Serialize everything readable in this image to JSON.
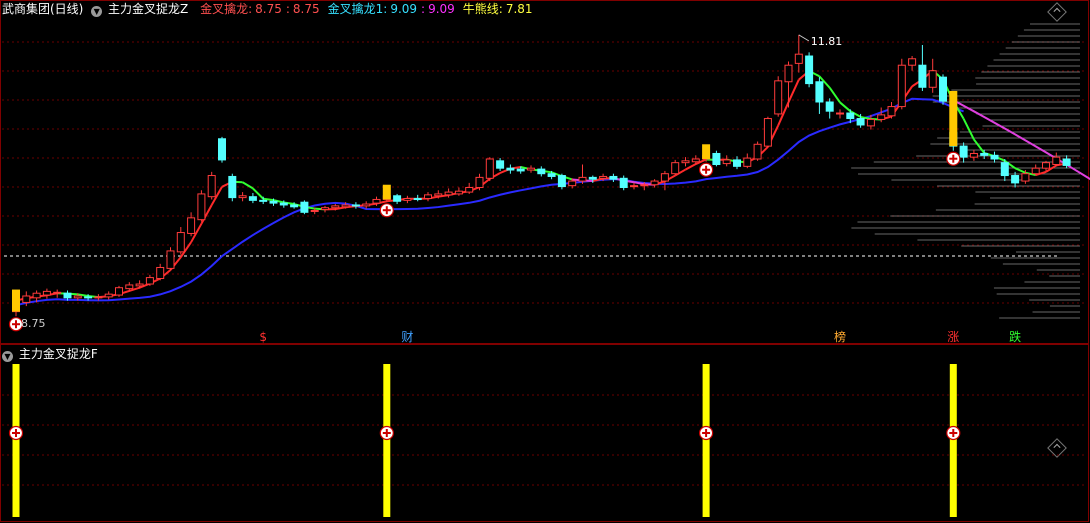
{
  "main_panel": {
    "stock_name": "武商集团(日线)",
    "indicator_name": "主力金叉捉龙Z",
    "params": [
      {
        "label": "金叉擒龙:",
        "value": "8.75",
        "color": "#ff5050"
      },
      {
        "label": ":",
        "value": "8.75",
        "color": "#ff5050"
      },
      {
        "label": "金叉擒龙1:",
        "value": "9.09",
        "color": "#36e0ff"
      },
      {
        "label": ":",
        "value": "9.09",
        "color": "#ff30ff"
      },
      {
        "label": "牛熊线:",
        "value": "7.81",
        "color": "#ffff40"
      }
    ],
    "high_label": "11.81",
    "low_label": "8.75",
    "signal_texts": [
      {
        "text": "$",
        "color": "#ff3030"
      },
      {
        "text": "财",
        "color": "#40a0ff"
      },
      {
        "text": "榜",
        "color": "#ffaa30"
      },
      {
        "text": "涨",
        "color": "#ff3030"
      },
      {
        "text": "跌",
        "color": "#30ff30"
      }
    ]
  },
  "sub_panel": {
    "indicator_name": "主力金叉捉龙F"
  },
  "icons": {
    "dropdown": "chevron-down-icon",
    "buy_marker": "plus-circle-icon",
    "corner": "diamond-icon"
  },
  "colors": {
    "up_candle": "#ff3b3b",
    "down_candle": "#54ffff",
    "ma_red": "#ff2a2a",
    "ma_green": "#30ff30",
    "ma_magenta": "#e040e0",
    "bull_bear_line": "#2a2aff",
    "grid": "#6a0000",
    "signal_bar": "#ffff00"
  },
  "chart_data": {
    "type": "candlestick",
    "title": "武商集团(日线)",
    "y_high_marker": 11.81,
    "y_low_marker": 8.75,
    "candles": [
      {
        "o": 8.8,
        "c": 8.92,
        "h": 8.98,
        "l": 8.75
      },
      {
        "o": 8.9,
        "c": 8.97,
        "h": 9.02,
        "l": 8.86
      },
      {
        "o": 8.95,
        "c": 9.0,
        "h": 9.03,
        "l": 8.9
      },
      {
        "o": 8.98,
        "c": 9.02,
        "h": 9.05,
        "l": 8.94
      },
      {
        "o": 9.0,
        "c": 9.01,
        "h": 9.04,
        "l": 8.95
      },
      {
        "o": 9.0,
        "c": 8.95,
        "h": 9.03,
        "l": 8.92
      },
      {
        "o": 8.95,
        "c": 8.97,
        "h": 9.0,
        "l": 8.92
      },
      {
        "o": 8.96,
        "c": 8.95,
        "h": 8.99,
        "l": 8.92
      },
      {
        "o": 8.95,
        "c": 8.96,
        "h": 8.99,
        "l": 8.92
      },
      {
        "o": 8.96,
        "c": 8.99,
        "h": 9.02,
        "l": 8.93
      },
      {
        "o": 8.98,
        "c": 9.06,
        "h": 9.08,
        "l": 8.96
      },
      {
        "o": 9.05,
        "c": 9.09,
        "h": 9.12,
        "l": 9.02
      },
      {
        "o": 9.08,
        "c": 9.1,
        "h": 9.14,
        "l": 9.05
      },
      {
        "o": 9.1,
        "c": 9.17,
        "h": 9.2,
        "l": 9.08
      },
      {
        "o": 9.16,
        "c": 9.28,
        "h": 9.32,
        "l": 9.14
      },
      {
        "o": 9.27,
        "c": 9.46,
        "h": 9.5,
        "l": 9.25
      },
      {
        "o": 9.45,
        "c": 9.66,
        "h": 9.72,
        "l": 9.42
      },
      {
        "o": 9.65,
        "c": 9.82,
        "h": 9.88,
        "l": 9.62
      },
      {
        "o": 9.8,
        "c": 10.08,
        "h": 10.12,
        "l": 9.78
      },
      {
        "o": 10.05,
        "c": 10.28,
        "h": 10.32,
        "l": 10.02
      },
      {
        "o": 10.68,
        "c": 10.45,
        "h": 10.7,
        "l": 10.42
      },
      {
        "o": 10.27,
        "c": 10.04,
        "h": 10.3,
        "l": 10.0
      },
      {
        "o": 10.04,
        "c": 10.06,
        "h": 10.1,
        "l": 10.0
      },
      {
        "o": 10.05,
        "c": 10.01,
        "h": 10.09,
        "l": 9.98
      },
      {
        "o": 10.01,
        "c": 10.0,
        "h": 10.05,
        "l": 9.97
      },
      {
        "o": 10.0,
        "c": 9.98,
        "h": 10.03,
        "l": 9.95
      },
      {
        "o": 9.98,
        "c": 9.96,
        "h": 10.01,
        "l": 9.93
      },
      {
        "o": 9.96,
        "c": 9.94,
        "h": 9.99,
        "l": 9.92
      },
      {
        "o": 9.99,
        "c": 9.88,
        "h": 10.01,
        "l": 9.86
      },
      {
        "o": 9.89,
        "c": 9.9,
        "h": 9.93,
        "l": 9.86
      },
      {
        "o": 9.91,
        "c": 9.93,
        "h": 9.95,
        "l": 9.88
      },
      {
        "o": 9.93,
        "c": 9.95,
        "h": 9.97,
        "l": 9.9
      },
      {
        "o": 9.94,
        "c": 9.96,
        "h": 9.99,
        "l": 9.92
      },
      {
        "o": 9.96,
        "c": 9.95,
        "h": 9.99,
        "l": 9.92
      },
      {
        "o": 9.95,
        "c": 9.97,
        "h": 10.0,
        "l": 9.92
      },
      {
        "o": 9.98,
        "c": 10.02,
        "h": 10.05,
        "l": 9.95
      },
      {
        "o": 10.02,
        "c": 10.06,
        "h": 10.08,
        "l": 9.99
      },
      {
        "o": 10.06,
        "c": 10.0,
        "h": 10.08,
        "l": 9.97
      },
      {
        "o": 10.01,
        "c": 10.03,
        "h": 10.06,
        "l": 9.98
      },
      {
        "o": 10.03,
        "c": 10.02,
        "h": 10.07,
        "l": 10.0
      },
      {
        "o": 10.03,
        "c": 10.07,
        "h": 10.1,
        "l": 10.0
      },
      {
        "o": 10.06,
        "c": 10.08,
        "h": 10.12,
        "l": 10.03
      },
      {
        "o": 10.07,
        "c": 10.1,
        "h": 10.14,
        "l": 10.04
      },
      {
        "o": 10.08,
        "c": 10.11,
        "h": 10.15,
        "l": 10.06
      },
      {
        "o": 10.1,
        "c": 10.15,
        "h": 10.2,
        "l": 10.08
      },
      {
        "o": 10.15,
        "c": 10.26,
        "h": 10.3,
        "l": 10.12
      },
      {
        "o": 10.25,
        "c": 10.46,
        "h": 10.48,
        "l": 10.22
      },
      {
        "o": 10.44,
        "c": 10.36,
        "h": 10.47,
        "l": 10.33
      },
      {
        "o": 10.36,
        "c": 10.34,
        "h": 10.4,
        "l": 10.3
      },
      {
        "o": 10.35,
        "c": 10.33,
        "h": 10.38,
        "l": 10.3
      },
      {
        "o": 10.34,
        "c": 10.36,
        "h": 10.39,
        "l": 10.31
      },
      {
        "o": 10.35,
        "c": 10.3,
        "h": 10.38,
        "l": 10.27
      },
      {
        "o": 10.3,
        "c": 10.27,
        "h": 10.33,
        "l": 10.24
      },
      {
        "o": 10.28,
        "c": 10.16,
        "h": 10.3,
        "l": 10.13
      },
      {
        "o": 10.17,
        "c": 10.22,
        "h": 10.25,
        "l": 10.14
      },
      {
        "o": 10.22,
        "c": 10.26,
        "h": 10.4,
        "l": 10.19
      },
      {
        "o": 10.26,
        "c": 10.24,
        "h": 10.28,
        "l": 10.2
      },
      {
        "o": 10.25,
        "c": 10.27,
        "h": 10.3,
        "l": 10.22
      },
      {
        "o": 10.27,
        "c": 10.24,
        "h": 10.3,
        "l": 10.21
      },
      {
        "o": 10.25,
        "c": 10.15,
        "h": 10.28,
        "l": 10.12
      },
      {
        "o": 10.16,
        "c": 10.17,
        "h": 10.2,
        "l": 10.13
      },
      {
        "o": 10.17,
        "c": 10.18,
        "h": 10.21,
        "l": 10.12
      },
      {
        "o": 10.18,
        "c": 10.22,
        "h": 10.24,
        "l": 10.15
      },
      {
        "o": 10.22,
        "c": 10.3,
        "h": 10.33,
        "l": 10.12
      },
      {
        "o": 10.3,
        "c": 10.42,
        "h": 10.45,
        "l": 10.28
      },
      {
        "o": 10.42,
        "c": 10.44,
        "h": 10.48,
        "l": 10.38
      },
      {
        "o": 10.43,
        "c": 10.46,
        "h": 10.5,
        "l": 10.4
      },
      {
        "o": 10.46,
        "c": 10.5,
        "h": 10.56,
        "l": 10.43
      },
      {
        "o": 10.52,
        "c": 10.4,
        "h": 10.55,
        "l": 10.38
      },
      {
        "o": 10.41,
        "c": 10.45,
        "h": 10.5,
        "l": 10.38
      },
      {
        "o": 10.45,
        "c": 10.38,
        "h": 10.49,
        "l": 10.35
      },
      {
        "o": 10.38,
        "c": 10.47,
        "h": 10.52,
        "l": 10.36
      },
      {
        "o": 10.46,
        "c": 10.62,
        "h": 10.65,
        "l": 10.44
      },
      {
        "o": 10.6,
        "c": 10.9,
        "h": 10.92,
        "l": 10.58
      },
      {
        "o": 10.95,
        "c": 11.31,
        "h": 11.36,
        "l": 10.92
      },
      {
        "o": 11.3,
        "c": 11.48,
        "h": 11.52,
        "l": 11.02
      },
      {
        "o": 11.5,
        "c": 11.6,
        "h": 11.81,
        "l": 11.4
      },
      {
        "o": 11.58,
        "c": 11.28,
        "h": 11.62,
        "l": 11.24
      },
      {
        "o": 11.3,
        "c": 11.08,
        "h": 11.35,
        "l": 10.95
      },
      {
        "o": 11.08,
        "c": 10.98,
        "h": 11.12,
        "l": 10.9
      },
      {
        "o": 10.96,
        "c": 10.96,
        "h": 11.0,
        "l": 10.9
      },
      {
        "o": 10.96,
        "c": 10.9,
        "h": 11.0,
        "l": 10.85
      },
      {
        "o": 10.9,
        "c": 10.83,
        "h": 10.95,
        "l": 10.8
      },
      {
        "o": 10.82,
        "c": 10.89,
        "h": 10.94,
        "l": 10.78
      },
      {
        "o": 10.89,
        "c": 10.94,
        "h": 11.02,
        "l": 10.86
      },
      {
        "o": 10.93,
        "c": 11.03,
        "h": 11.08,
        "l": 10.9
      },
      {
        "o": 11.03,
        "c": 11.48,
        "h": 11.55,
        "l": 11.0
      },
      {
        "o": 11.48,
        "c": 11.55,
        "h": 11.58,
        "l": 11.42
      },
      {
        "o": 11.48,
        "c": 11.24,
        "h": 11.7,
        "l": 11.2
      },
      {
        "o": 11.24,
        "c": 11.42,
        "h": 11.55,
        "l": 11.18
      },
      {
        "o": 11.35,
        "c": 11.09,
        "h": 11.38,
        "l": 11.05
      },
      {
        "o": 10.75,
        "c": 10.6,
        "h": 10.8,
        "l": 10.55
      },
      {
        "o": 10.6,
        "c": 10.48,
        "h": 10.64,
        "l": 10.42
      },
      {
        "o": 10.48,
        "c": 10.52,
        "h": 10.56,
        "l": 10.44
      },
      {
        "o": 10.52,
        "c": 10.5,
        "h": 10.56,
        "l": 10.46
      },
      {
        "o": 10.5,
        "c": 10.46,
        "h": 10.54,
        "l": 10.42
      },
      {
        "o": 10.42,
        "c": 10.28,
        "h": 10.46,
        "l": 10.22
      },
      {
        "o": 10.28,
        "c": 10.2,
        "h": 10.32,
        "l": 10.15
      },
      {
        "o": 10.22,
        "c": 10.3,
        "h": 10.34,
        "l": 10.19
      },
      {
        "o": 10.3,
        "c": 10.36,
        "h": 10.4,
        "l": 10.28
      },
      {
        "o": 10.36,
        "c": 10.42,
        "h": 10.44,
        "l": 10.33
      },
      {
        "o": 10.4,
        "c": 10.48,
        "h": 10.53,
        "l": 10.38
      },
      {
        "o": 10.46,
        "c": 10.39,
        "h": 10.5,
        "l": 10.36
      }
    ],
    "buy_signals": [
      0,
      36,
      67,
      91
    ],
    "signal_text_indices": [
      24,
      38,
      80,
      91,
      97
    ],
    "sub_bar_indices": [
      0,
      36,
      67,
      91
    ]
  }
}
